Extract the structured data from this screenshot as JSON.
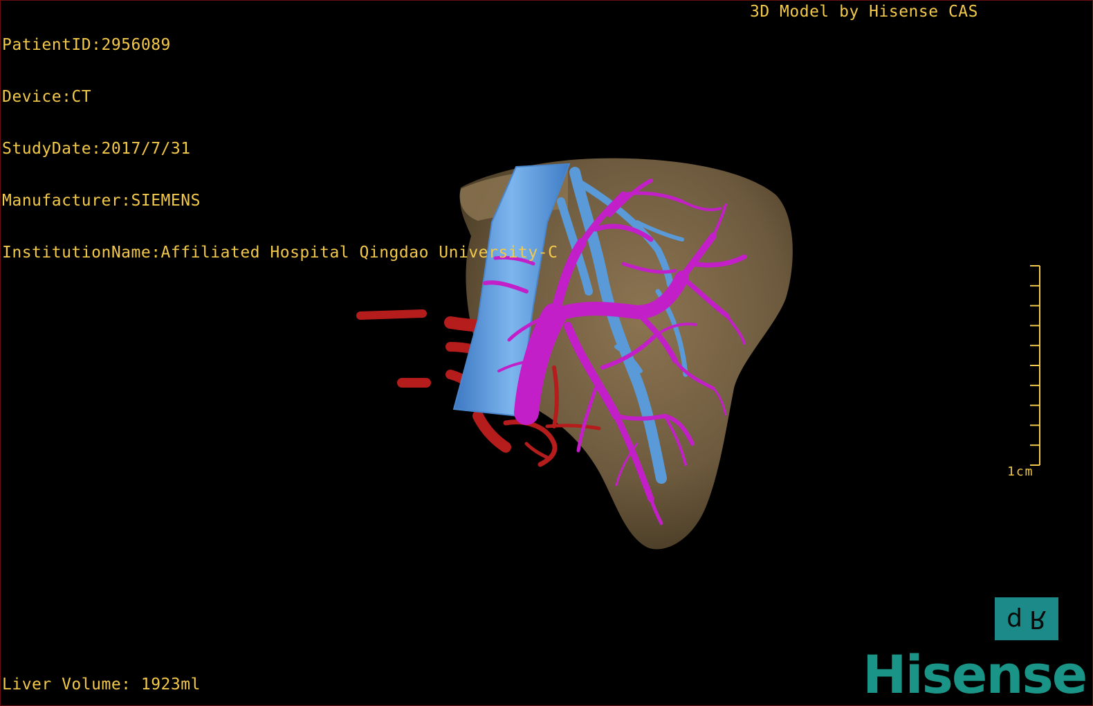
{
  "patient_info": {
    "patient_id": "PatientID:2956089",
    "device": "Device:CT",
    "study_date": "StudyDate:2017/7/31",
    "manufacturer": "Manufacturer:SIEMENS",
    "institution": "InstitutionName:Affiliated Hospital Qingdao University-C"
  },
  "model_credit": "3D Model by Hisense CAS",
  "liver_volume": "Liver Volume: 1923ml",
  "scale_bar": {
    "label": "1cm",
    "tick_count": 10
  },
  "orientation_marker": {
    "left_glyph": "d",
    "right_glyph": "R"
  },
  "brand_logo": "Hisense",
  "colors": {
    "overlay_text": "#f3c94a",
    "liver": "#7a6446",
    "hepatic_artery": "#b51c1c",
    "portal_vein": "#c21fc8",
    "hepatic_vein": "#5a9ad8",
    "logo": "#1a9486",
    "orientation_cube": "#1d8a8a"
  }
}
